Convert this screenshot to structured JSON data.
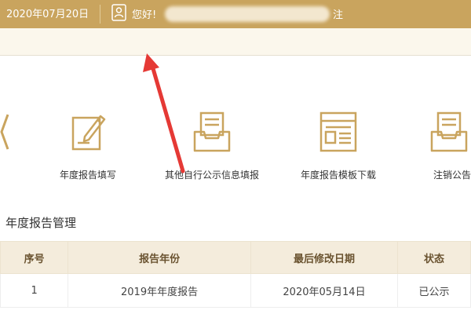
{
  "header": {
    "date": "2020年07月20日",
    "greeting": "您好!",
    "logout_fragment": "注销"
  },
  "functions": [
    {
      "label": "年度报告填写",
      "icon": "edit-form-icon"
    },
    {
      "label": "其他自行公示信息填报",
      "icon": "inbox-document-icon"
    },
    {
      "label": "年度报告模板下载",
      "icon": "template-window-icon"
    },
    {
      "label": "注销公告",
      "icon": "inbox-document-icon"
    }
  ],
  "section": {
    "title": "年度报告管理"
  },
  "table": {
    "columns": [
      "序号",
      "报告年份",
      "最后修改日期",
      "状态"
    ],
    "rows": [
      {
        "index": "1",
        "report_year": "2019年年度报告",
        "modified": "2020年05月14日",
        "status": "已公示"
      }
    ]
  },
  "colors": {
    "header_bg": "#c9a45e",
    "icon_gold": "#c9a45e",
    "annotation_arrow": "#e53935"
  }
}
